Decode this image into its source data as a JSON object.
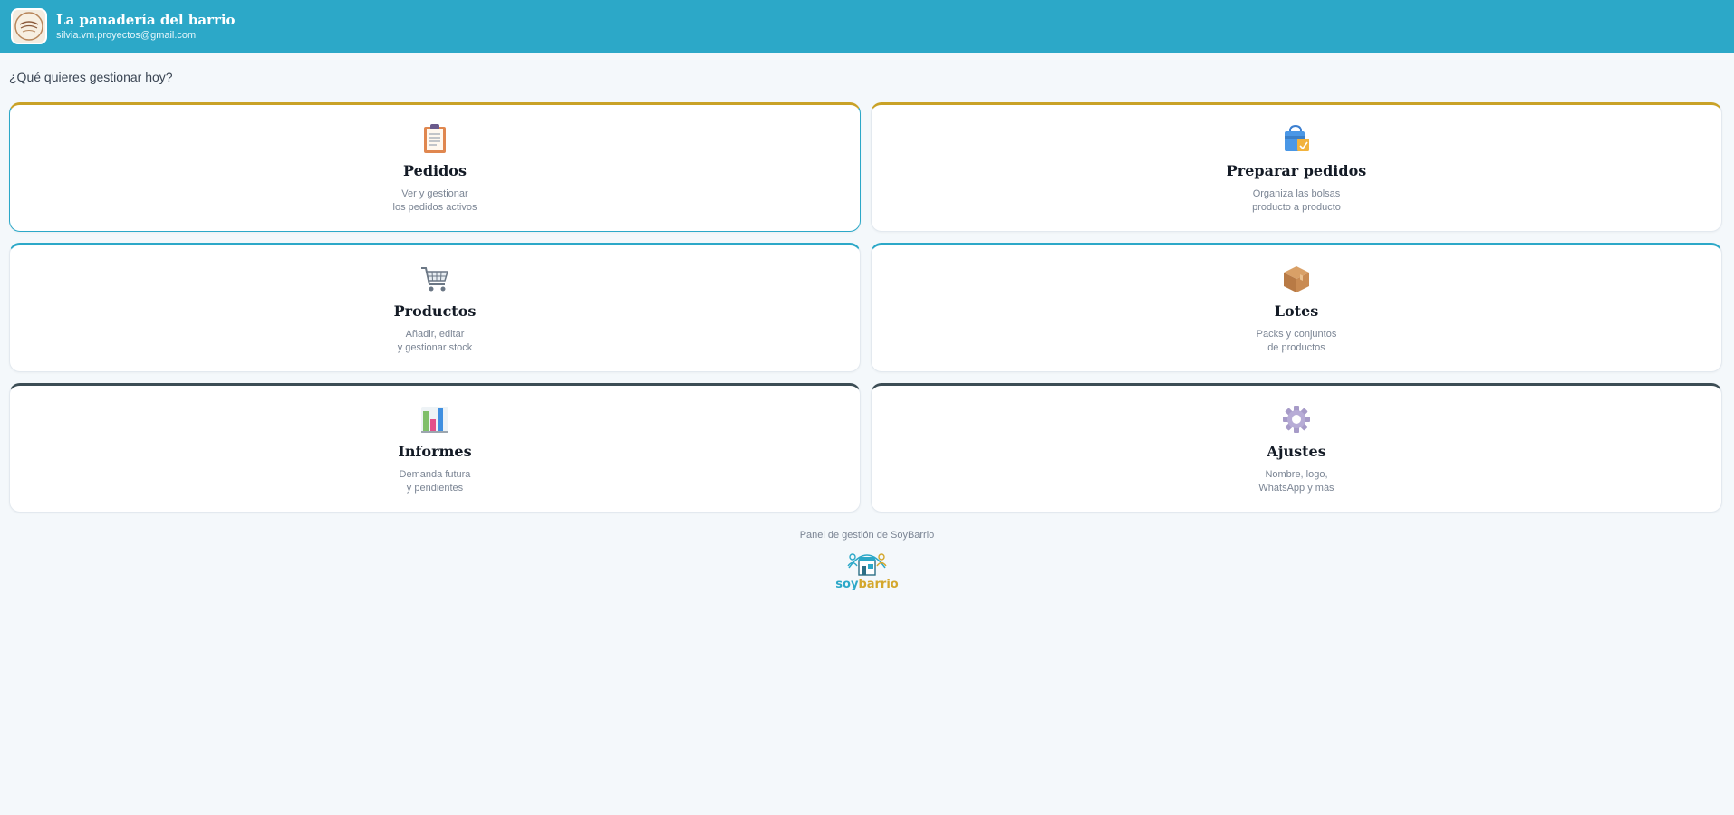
{
  "header": {
    "store_name": "La panadería del barrio",
    "store_email": "silvia.vm.proyectos@gmail.com",
    "logo_icon": "store-logo-icon"
  },
  "main": {
    "question": "¿Qué quieres gestionar hoy?",
    "cards": [
      {
        "title": "Pedidos",
        "desc_line1": "Ver y gestionar",
        "desc_line2": "los pedidos activos",
        "icon": "clipboard-icon"
      },
      {
        "title": "Preparar pedidos",
        "desc_line1": "Organiza las bolsas",
        "desc_line2": "producto a producto",
        "icon": "shopping-bag-icon"
      },
      {
        "title": "Productos",
        "desc_line1": "Añadir, editar",
        "desc_line2": "y gestionar stock",
        "icon": "cart-icon"
      },
      {
        "title": "Lotes",
        "desc_line1": "Packs y conjuntos",
        "desc_line2": "de productos",
        "icon": "box-icon"
      },
      {
        "title": "Informes",
        "desc_line1": "Demanda futura",
        "desc_line2": "y pendientes",
        "icon": "bar-chart-icon"
      },
      {
        "title": "Ajustes",
        "desc_line1": "Nombre, logo,",
        "desc_line2": "WhatsApp y más",
        "icon": "gear-icon"
      }
    ]
  },
  "footer": {
    "text": "Panel de gestión de SoyBarrio",
    "brand_soy": "soy",
    "brand_barrio": "barrio"
  },
  "colors": {
    "header_bg": "#2ca8c8",
    "accent_gold": "#c9a227",
    "accent_blue": "#2ca8c8",
    "accent_dark": "#3c4d55",
    "page_bg": "#f4f8fb"
  }
}
